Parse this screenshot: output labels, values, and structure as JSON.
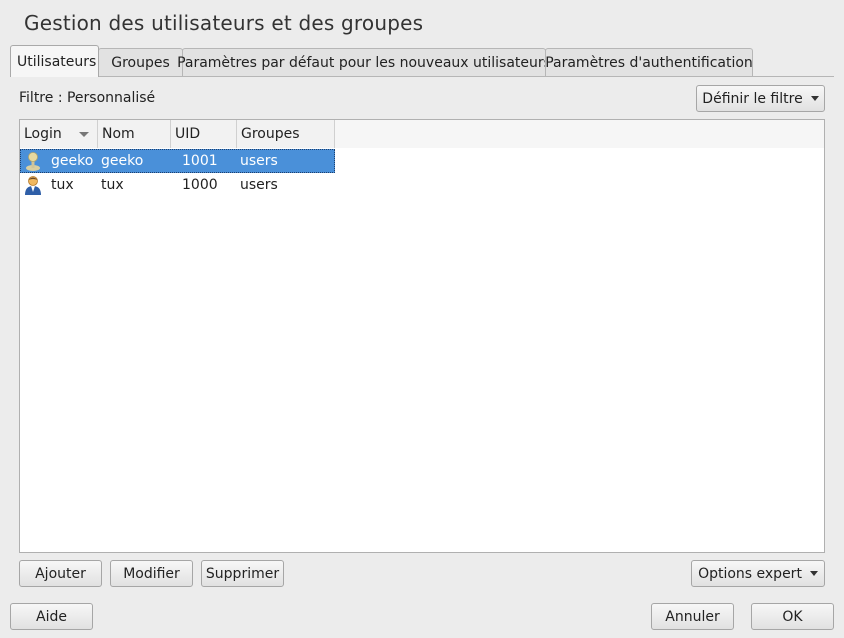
{
  "window": {
    "title": "Gestion des utilisateurs et des groupes"
  },
  "tabs": [
    {
      "label": "Utilisateurs",
      "active": true
    },
    {
      "label": "Groupes",
      "active": false
    },
    {
      "label": "Paramètres par défaut pour les nouveaux utilisateurs",
      "active": false
    },
    {
      "label": "Paramètres d'authentification",
      "active": false
    }
  ],
  "filter": {
    "label": "Filtre : Personnalisé",
    "button_label": "Définir le filtre"
  },
  "table": {
    "columns": [
      "Login",
      "Nom",
      "UID",
      "Groupes"
    ],
    "sort_column": "Login",
    "rows": [
      {
        "login": "geeko",
        "name": "geeko",
        "uid": "1001",
        "groups": "users",
        "selected": true,
        "icon": "user-icon-geeko"
      },
      {
        "login": "tux",
        "name": "tux",
        "uid": "1000",
        "groups": "users",
        "selected": false,
        "icon": "user-icon-tux"
      }
    ]
  },
  "actions": {
    "add": "Ajouter",
    "edit": "Modifier",
    "delete": "Supprimer",
    "expert": "Options expert"
  },
  "footer": {
    "help": "Aide",
    "cancel": "Annuler",
    "ok": "OK"
  },
  "colors": {
    "selection": "#4a90d9",
    "background": "#ececec"
  }
}
